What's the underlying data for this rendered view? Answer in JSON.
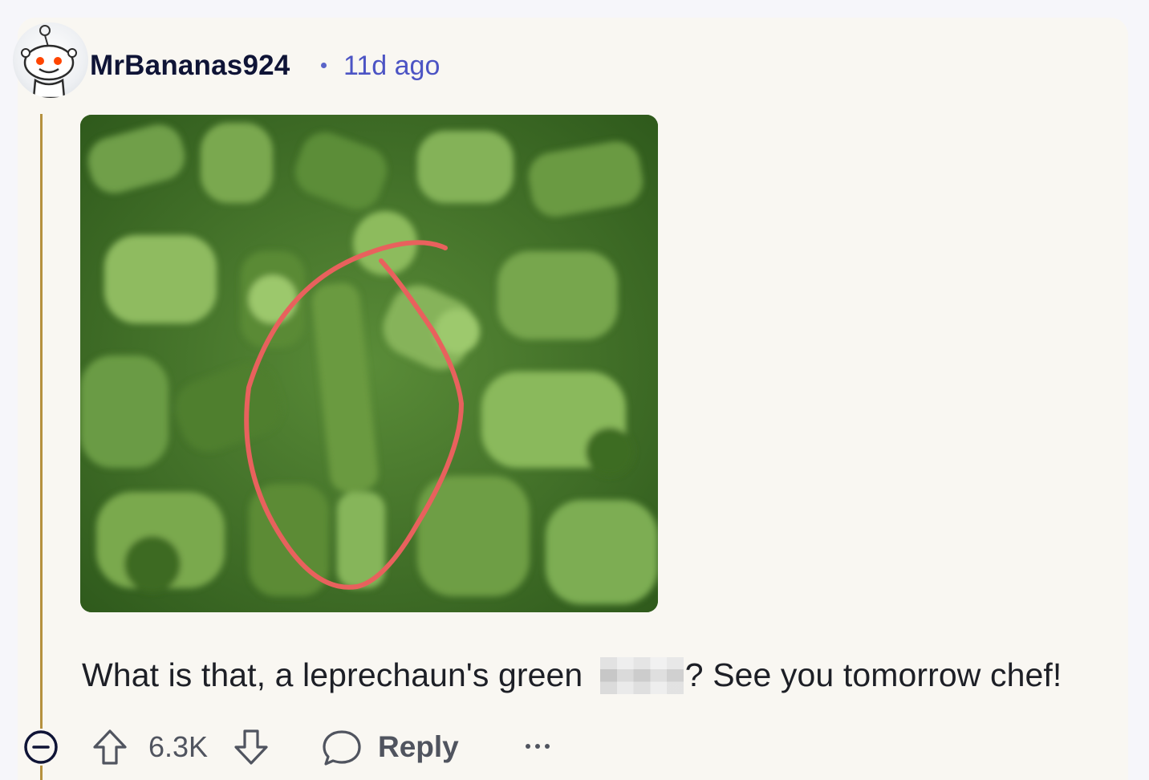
{
  "comment": {
    "author": "MrBananas924",
    "separator": "•",
    "timestamp": "11d ago",
    "text_before": "What is that, a leprechaun's green ",
    "text_after": "? See you tomorrow chef!",
    "image": {
      "subject": "close-up of chopped green onions with a red hand-drawn circle",
      "annotation_color": "#e8615d"
    }
  },
  "actions": {
    "upvote_icon": "arrow-up-icon",
    "score": "6.3K",
    "downvote_icon": "arrow-down-icon",
    "reply_icon": "speech-bubble-icon",
    "reply_label": "Reply",
    "more_icon": "ellipsis-icon",
    "collapse_icon": "minus-circle-icon"
  },
  "colors": {
    "thread_line": "#b5913f",
    "username": "#0f1436",
    "timestamp": "#4c54c4",
    "text": "#1d1f26",
    "action": "#50545f"
  }
}
